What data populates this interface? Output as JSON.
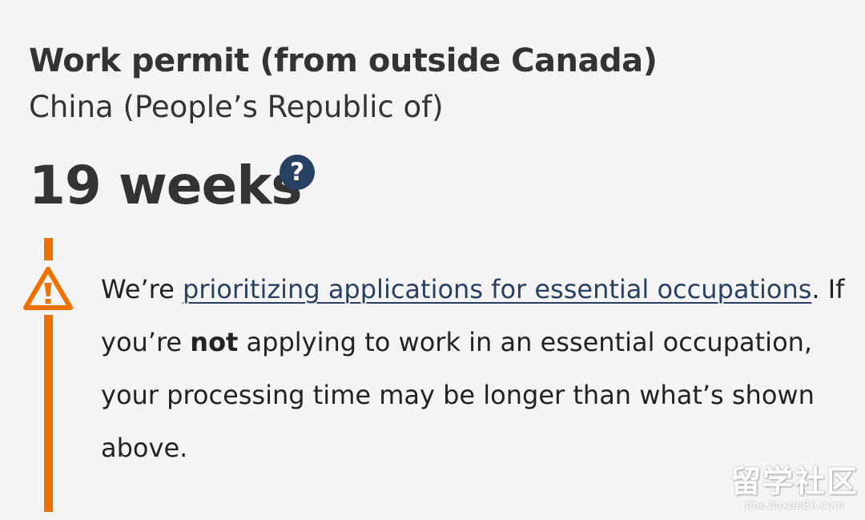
{
  "heading": "Work permit (from outside Canada)",
  "country": "China (People’s Republic of)",
  "processing_time": "19 weeks",
  "help_icon": "question-circle-icon",
  "help_symbol": "?",
  "alert": {
    "icon": "warning-triangle-icon",
    "intro": "We’re ",
    "link_text": "prioritizing applications for essential occupations",
    "after_link": ".",
    "line2_before": " If you’re ",
    "emphasis": "not",
    "line2_after": " applying to work in an essential occupation, your processing time may be longer than what’s shown above."
  },
  "watermark": {
    "main": "留学社区",
    "sub": "bbs.liuxue86.com"
  },
  "colors": {
    "accent_orange": "#ee7100",
    "link_blue": "#284162",
    "text": "#333333",
    "background": "#f4f4f4"
  }
}
